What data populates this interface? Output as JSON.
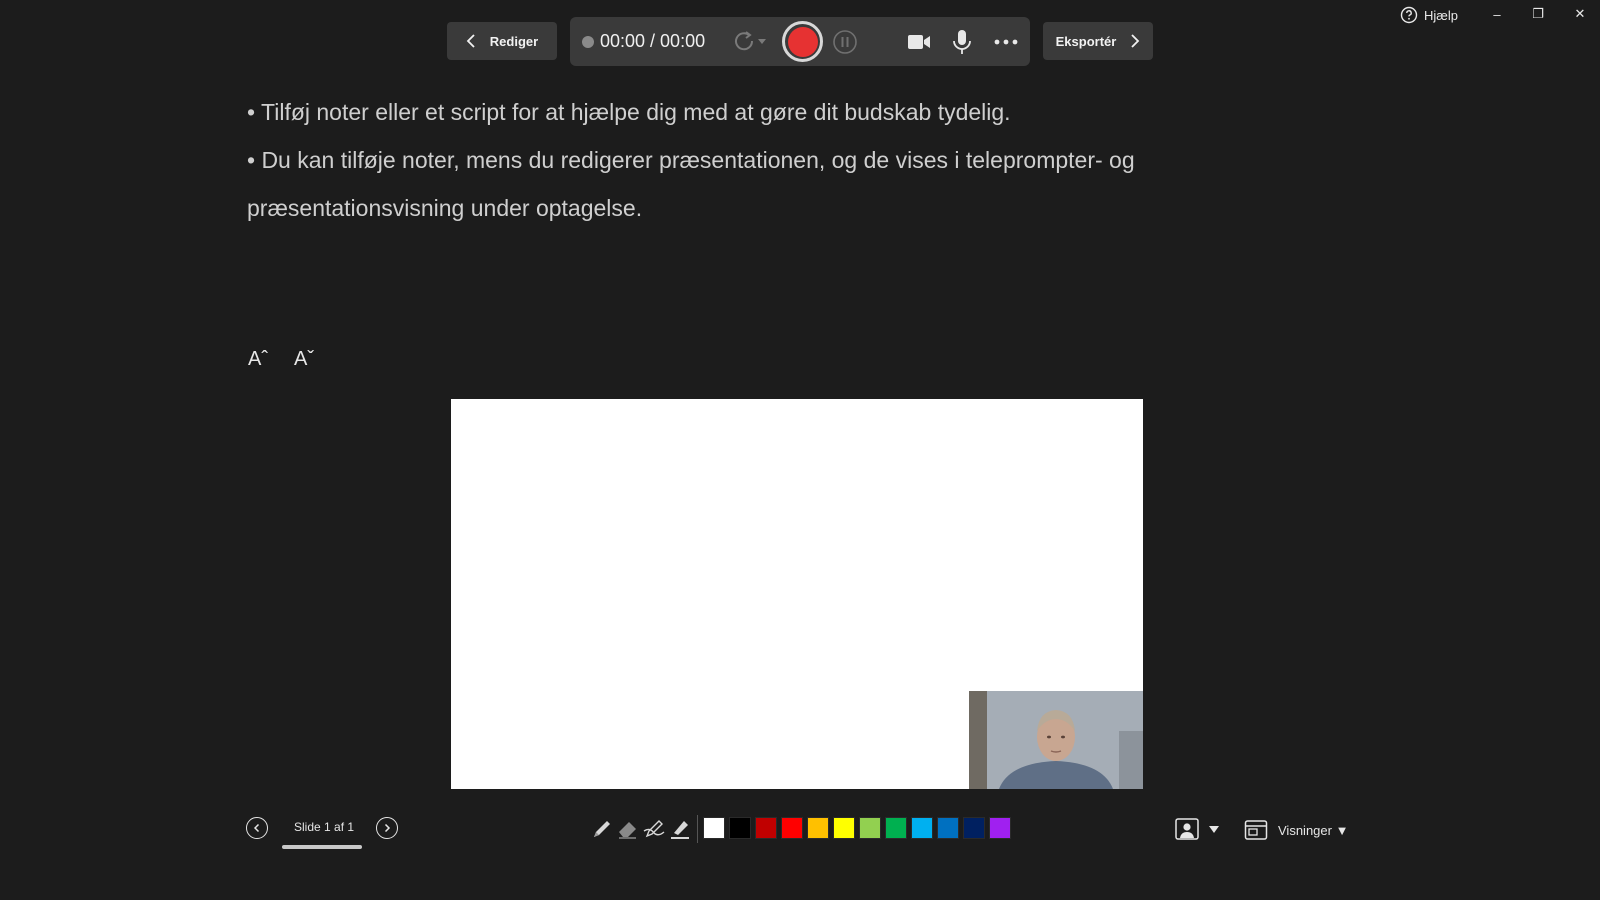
{
  "window": {
    "help_label": "Hjælp",
    "minimize_glyph": "–",
    "restore_glyph": "❐",
    "close_glyph": "✕"
  },
  "toolbar": {
    "edit_label": "Rediger",
    "timer": "00:00 / 00:00",
    "export_label": "Eksportér"
  },
  "notes": {
    "lines": [
      "• Tilføj noter eller et script for at hjælpe dig med at gøre dit budskab tydelig.",
      "• Du kan tilføje noter, mens du redigerer præsentationen, og de vises i teleprompter- og",
      "præsentationsvisning under optagelse."
    ],
    "font_increase_label": "Aˆ",
    "font_decrease_label": "Aˇ"
  },
  "slide_nav": {
    "counter": "Slide 1 af 1"
  },
  "ink_colors": [
    "#ffffff",
    "#000000",
    "#c00000",
    "#ff0000",
    "#ffc000",
    "#ffff00",
    "#92d050",
    "#00b050",
    "#00b0f0",
    "#0070c0",
    "#002060",
    "#a020f0"
  ],
  "views": {
    "label": "Visninger ▼"
  },
  "icons": [
    "help-icon",
    "chevron-left-icon",
    "chevron-right-icon",
    "replay-icon",
    "pause-icon",
    "camera-icon",
    "microphone-icon",
    "more-icon",
    "pen-icon",
    "eraser-icon",
    "laser-pen-icon",
    "highlighter-icon",
    "camera-mode-icon",
    "views-icon"
  ]
}
